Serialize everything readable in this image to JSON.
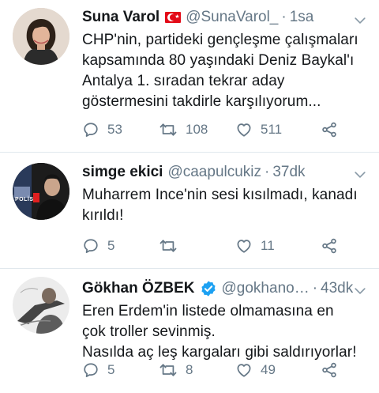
{
  "tweets": [
    {
      "name": "Suna Varol",
      "handle": "@SunaVarol_",
      "separator": "·",
      "time": "1sa",
      "text": "CHP'nin, partideki gençleşme çalışmaları\nkapsamında  80 yaşındaki Deniz Baykal'ı\nAntalya 1. sıradan tekrar aday\ngöstermesini takdirle karşılıyorum...",
      "replies": "53",
      "retweets": "108",
      "likes": "511"
    },
    {
      "name": "simge ekici",
      "handle": "@caapulcukiz",
      "separator": "·",
      "time": "37dk",
      "text": "Muharrem Ince'nin sesi kısılmadı, kanadı\nkırıldı!",
      "replies": "5",
      "retweets": "",
      "likes": "11",
      "avatar_text": "POLİS"
    },
    {
      "name": "Gökhan ÖZBEK",
      "handle": "@gokhano…",
      "separator": "·",
      "time": "43dk",
      "text": "Eren Erdem'in listede olmamasına en\nçok troller sevinmiş.\nNasılda aç leş kargaları gibi saldırıyorlar!",
      "replies": "5",
      "retweets": "8",
      "likes": "49"
    }
  ],
  "colors": {
    "text": "#14171a",
    "muted": "#657786",
    "verified": "#1da1f2",
    "flag": "#e30a17",
    "divider": "#e1e8ed"
  },
  "icons": [
    "reply-icon",
    "retweet-icon",
    "like-icon",
    "share-icon",
    "chevron-down-icon",
    "verified-badge-icon",
    "turkey-flag-icon"
  ]
}
